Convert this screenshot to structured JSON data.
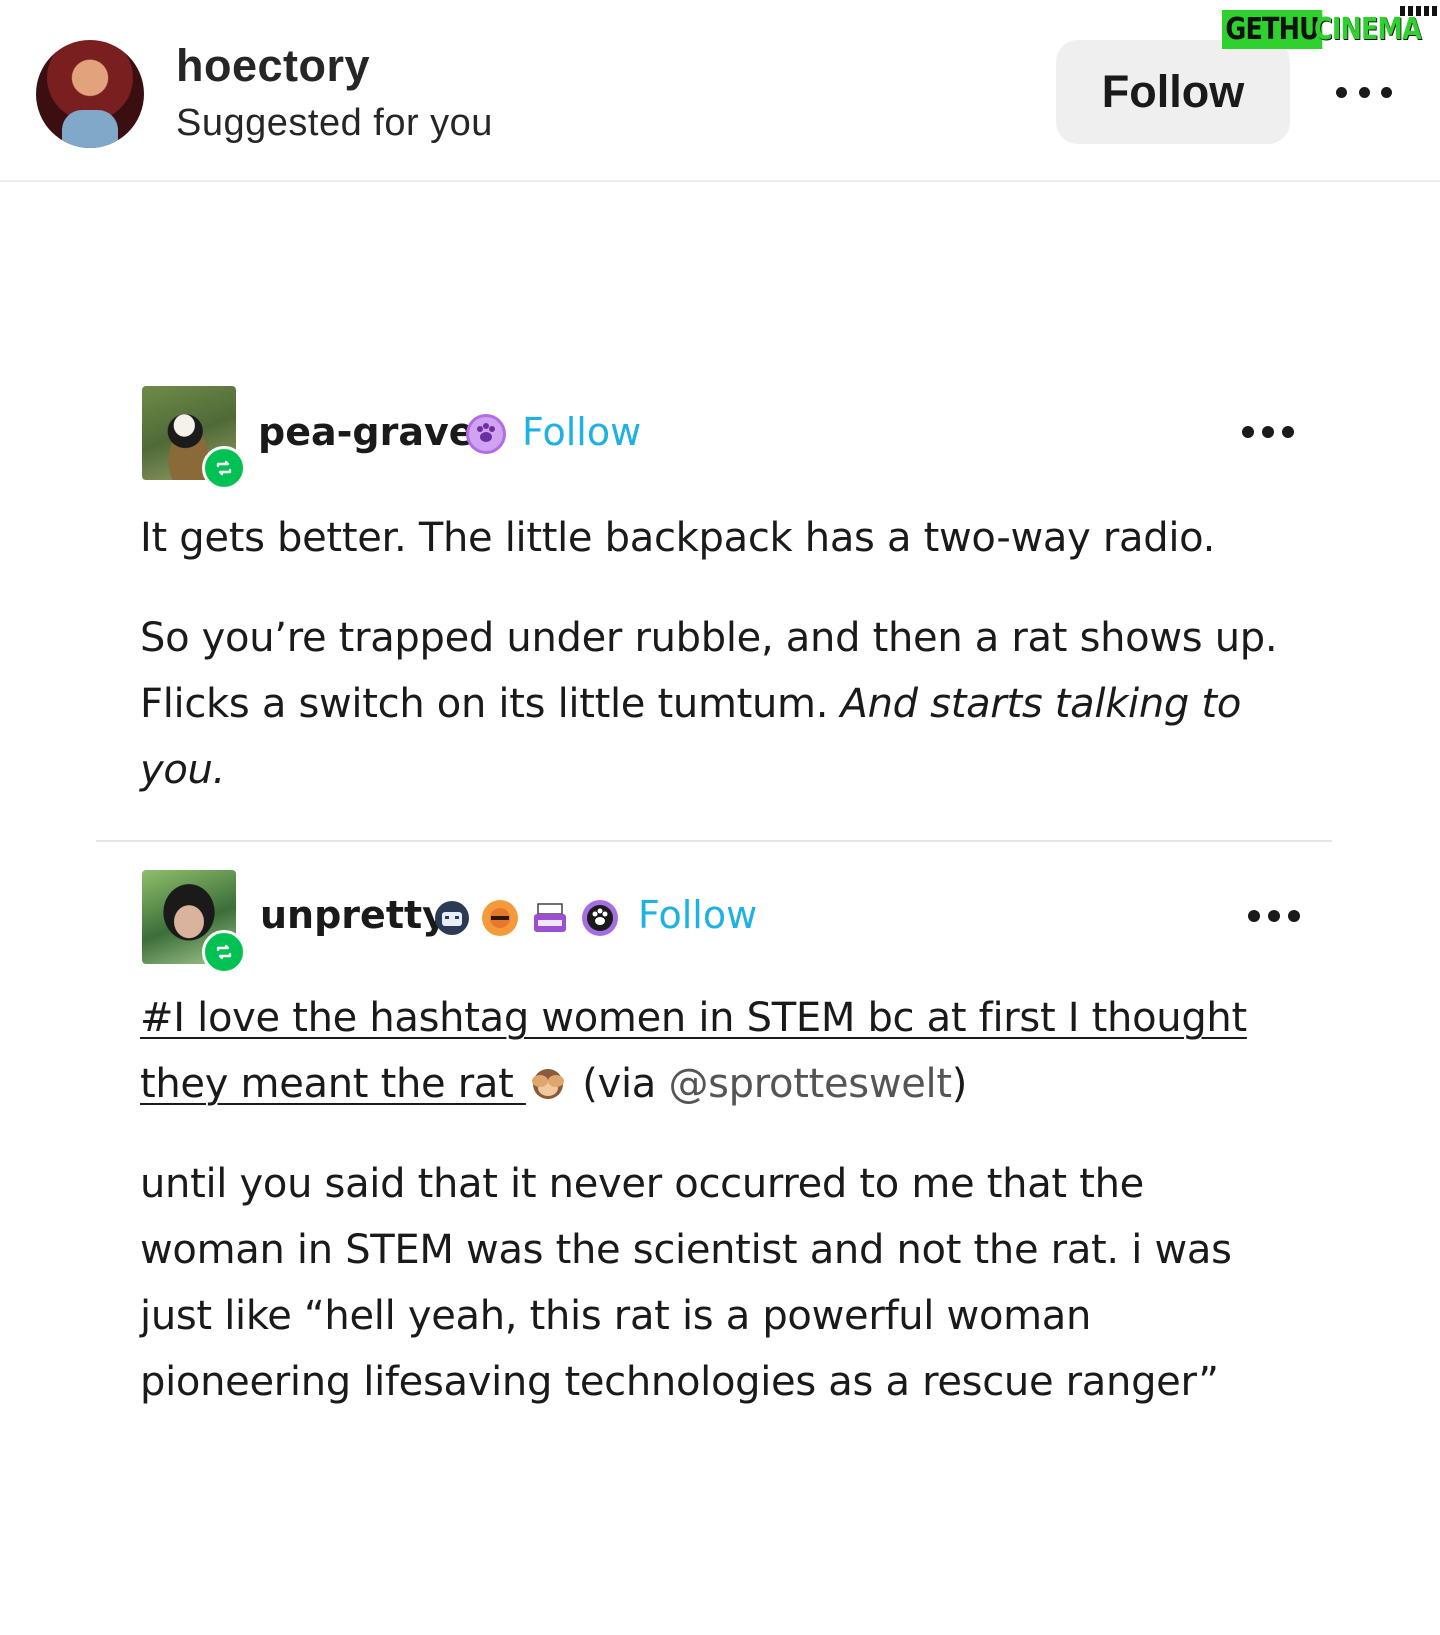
{
  "watermark": {
    "left": "GETHU",
    "right": "CINEMA"
  },
  "header": {
    "username": "hoectory",
    "subtitle": "Suggested for you",
    "follow_label": "Follow",
    "more_icon": "more-horizontal-icon"
  },
  "posts": [
    {
      "username": "pea-gravel",
      "badges": [
        "paw-badge-icon"
      ],
      "follow_label": "Follow",
      "more_icon": "more-horizontal-icon",
      "paragraph1": "It gets better. The little backpack has a two-way radio.",
      "paragraph2_normal": "So you’re trapped under rubble, and then a rat shows up. Flicks a switch on its little tumtum. ",
      "paragraph2_italic": "And starts talking to you."
    },
    {
      "username": "unpretty",
      "badges": [
        "robot-badge-icon",
        "sun-badge-icon",
        "typewriter-badge-icon",
        "paw-badge-icon"
      ],
      "follow_label": "Follow",
      "more_icon": "more-horizontal-icon",
      "tag_text": "#I love the hashtag women in STEM bc at first I thought they meant the rat ",
      "via_prefix": " (via ",
      "via_mention": "@sprotteswelt",
      "via_suffix": ")",
      "paragraph2": "until you said that it never occurred to me that the woman in STEM was the scientist and not the rat. i was just like “hell yeah, this rat is a powerful woman pioneering lifesaving technologies as a rescue ranger”"
    }
  ],
  "colors": {
    "follow_blue": "#1db1e4",
    "reblog_green": "#00c253",
    "header_follow_bg": "#efefef"
  }
}
